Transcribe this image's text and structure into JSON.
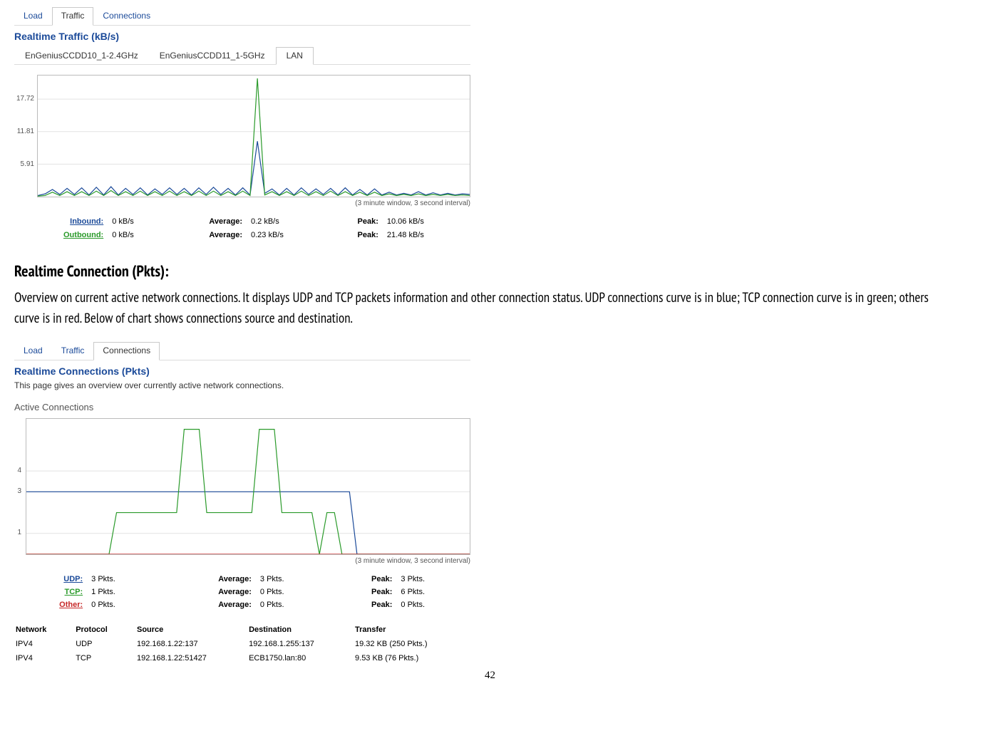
{
  "top": {
    "tabs": {
      "load": "Load",
      "traffic": "Traffic",
      "connections": "Connections"
    },
    "title": "Realtime Traffic (kB/s)",
    "subtabs": {
      "g24": "EnGeniusCCDD10_1-2.4GHz",
      "g5": "EnGeniusCCDD11_1-5GHz",
      "lan": "LAN"
    },
    "caption": "(3 minute window, 3 second interval)",
    "chart_data": {
      "type": "line",
      "x_range_seconds": 180,
      "sample_interval_seconds": 3,
      "ylim": [
        0,
        22
      ],
      "yticks": [
        5.91,
        11.81,
        17.72
      ],
      "series": [
        {
          "name": "Inbound",
          "color": "#1b4a99",
          "values": [
            0.2,
            0.5,
            1.3,
            0.4,
            1.5,
            0.4,
            1.6,
            0.3,
            1.7,
            0.3,
            1.8,
            0.3,
            1.5,
            0.4,
            1.6,
            0.3,
            1.4,
            0.4,
            1.6,
            0.4,
            1.5,
            0.3,
            1.6,
            0.4,
            1.7,
            0.4,
            1.5,
            0.3,
            1.6,
            0.3,
            10.06,
            0.6,
            1.4,
            0.3,
            1.5,
            0.3,
            1.6,
            0.4,
            1.4,
            0.4,
            1.5,
            0.3,
            1.6,
            0.3,
            1.3,
            0.3,
            1.4,
            0.3,
            0.8,
            0.3,
            0.6,
            0.3,
            0.9,
            0.3,
            0.7,
            0.3,
            0.6,
            0.3,
            0.5,
            0.4
          ]
        },
        {
          "name": "Outbound",
          "color": "#2a9a2a",
          "values": [
            0.1,
            0.2,
            0.8,
            0.2,
            0.9,
            0.2,
            0.9,
            0.2,
            1.0,
            0.2,
            1.1,
            0.2,
            0.9,
            0.2,
            1.0,
            0.2,
            0.9,
            0.2,
            1.0,
            0.2,
            0.9,
            0.2,
            1.0,
            0.2,
            1.0,
            0.2,
            0.9,
            0.2,
            1.0,
            0.2,
            21.48,
            0.3,
            0.9,
            0.2,
            0.9,
            0.2,
            1.0,
            0.2,
            0.9,
            0.2,
            1.0,
            0.2,
            0.9,
            0.2,
            0.8,
            0.2,
            0.8,
            0.2,
            0.5,
            0.2,
            0.4,
            0.2,
            0.5,
            0.2,
            0.4,
            0.2,
            0.4,
            0.2,
            0.3,
            0.2
          ]
        }
      ]
    },
    "stats": {
      "inbound": {
        "label": "Inbound:",
        "now": "0 kB/s",
        "avg_label": "Average:",
        "avg": "0.2 kB/s",
        "peak_label": "Peak:",
        "peak": "10.06 kB/s"
      },
      "outbound": {
        "label": "Outbound:",
        "now": "0 kB/s",
        "avg_label": "Average:",
        "avg": "0.23 kB/s",
        "peak_label": "Peak:",
        "peak": "21.48 kB/s"
      }
    }
  },
  "doc": {
    "heading": "Realtime Connection (Pkts):",
    "body": "Overview on current active network connections. It displays UDP and TCP packets information and other connection status. UDP connections curve is in blue; TCP connection curve is in green; others curve is in red. Below of chart shows connections source and destination."
  },
  "bottom": {
    "tabs": {
      "load": "Load",
      "traffic": "Traffic",
      "connections": "Connections"
    },
    "title": "Realtime Connections (Pkts)",
    "subtitle": "This page gives an overview over currently active network connections.",
    "legend": "Active Connections",
    "caption": "(3 minute window, 3 second interval)",
    "chart_data": {
      "type": "line",
      "x_range_seconds": 180,
      "sample_interval_seconds": 3,
      "ylim": [
        0,
        6.5
      ],
      "yticks": [
        1,
        3,
        4
      ],
      "series": [
        {
          "name": "UDP",
          "color": "#1b4a99",
          "values": [
            3,
            3,
            3,
            3,
            3,
            3,
            3,
            3,
            3,
            3,
            3,
            3,
            3,
            3,
            3,
            3,
            3,
            3,
            3,
            3,
            3,
            3,
            3,
            3,
            3,
            3,
            3,
            3,
            3,
            3,
            3,
            3,
            3,
            3,
            3,
            3,
            3,
            3,
            3,
            3,
            3,
            3,
            3,
            3,
            0,
            0,
            0,
            0,
            0,
            0,
            0,
            0,
            0,
            0,
            0,
            0,
            0,
            0,
            0,
            0
          ]
        },
        {
          "name": "TCP",
          "color": "#2a9a2a",
          "values": [
            0,
            0,
            0,
            0,
            0,
            0,
            0,
            0,
            0,
            0,
            0,
            0,
            2,
            2,
            2,
            2,
            2,
            2,
            2,
            2,
            2,
            6,
            6,
            6,
            2,
            2,
            2,
            2,
            2,
            2,
            2,
            6,
            6,
            6,
            2,
            2,
            2,
            2,
            2,
            0,
            2,
            2,
            0,
            0,
            0,
            0,
            0,
            0,
            0,
            0,
            0,
            0,
            0,
            0,
            0,
            0,
            0,
            0,
            0,
            0
          ]
        },
        {
          "name": "Other",
          "color": "#c62828",
          "values": [
            0,
            0,
            0,
            0,
            0,
            0,
            0,
            0,
            0,
            0,
            0,
            0,
            0,
            0,
            0,
            0,
            0,
            0,
            0,
            0,
            0,
            0,
            0,
            0,
            0,
            0,
            0,
            0,
            0,
            0,
            0,
            0,
            0,
            0,
            0,
            0,
            0,
            0,
            0,
            0,
            0,
            0,
            0,
            0,
            0,
            0,
            0,
            0,
            0,
            0,
            0,
            0,
            0,
            0,
            0,
            0,
            0,
            0,
            0,
            0
          ]
        }
      ]
    },
    "stats": {
      "udp": {
        "label": "UDP:",
        "now": "3 Pkts.",
        "avg_label": "Average:",
        "avg": "3 Pkts.",
        "peak_label": "Peak:",
        "peak": "3 Pkts."
      },
      "tcp": {
        "label": "TCP:",
        "now": "1 Pkts.",
        "avg_label": "Average:",
        "avg": "0 Pkts.",
        "peak_label": "Peak:",
        "peak": "6 Pkts."
      },
      "other": {
        "label": "Other:",
        "now": "0 Pkts.",
        "avg_label": "Average:",
        "avg": "0 Pkts.",
        "peak_label": "Peak:",
        "peak": "0 Pkts."
      }
    },
    "table": {
      "headers": {
        "network": "Network",
        "protocol": "Protocol",
        "source": "Source",
        "destination": "Destination",
        "transfer": "Transfer"
      },
      "rows": [
        {
          "network": "IPV4",
          "protocol": "UDP",
          "source": "192.168.1.22:137",
          "destination": "192.168.1.255:137",
          "transfer": "19.32 KB (250 Pkts.)"
        },
        {
          "network": "IPV4",
          "protocol": "TCP",
          "source": "192.168.1.22:51427",
          "destination": "ECB1750.lan:80",
          "transfer": "9.53 KB (76 Pkts.)"
        }
      ]
    }
  },
  "page_number": "42"
}
